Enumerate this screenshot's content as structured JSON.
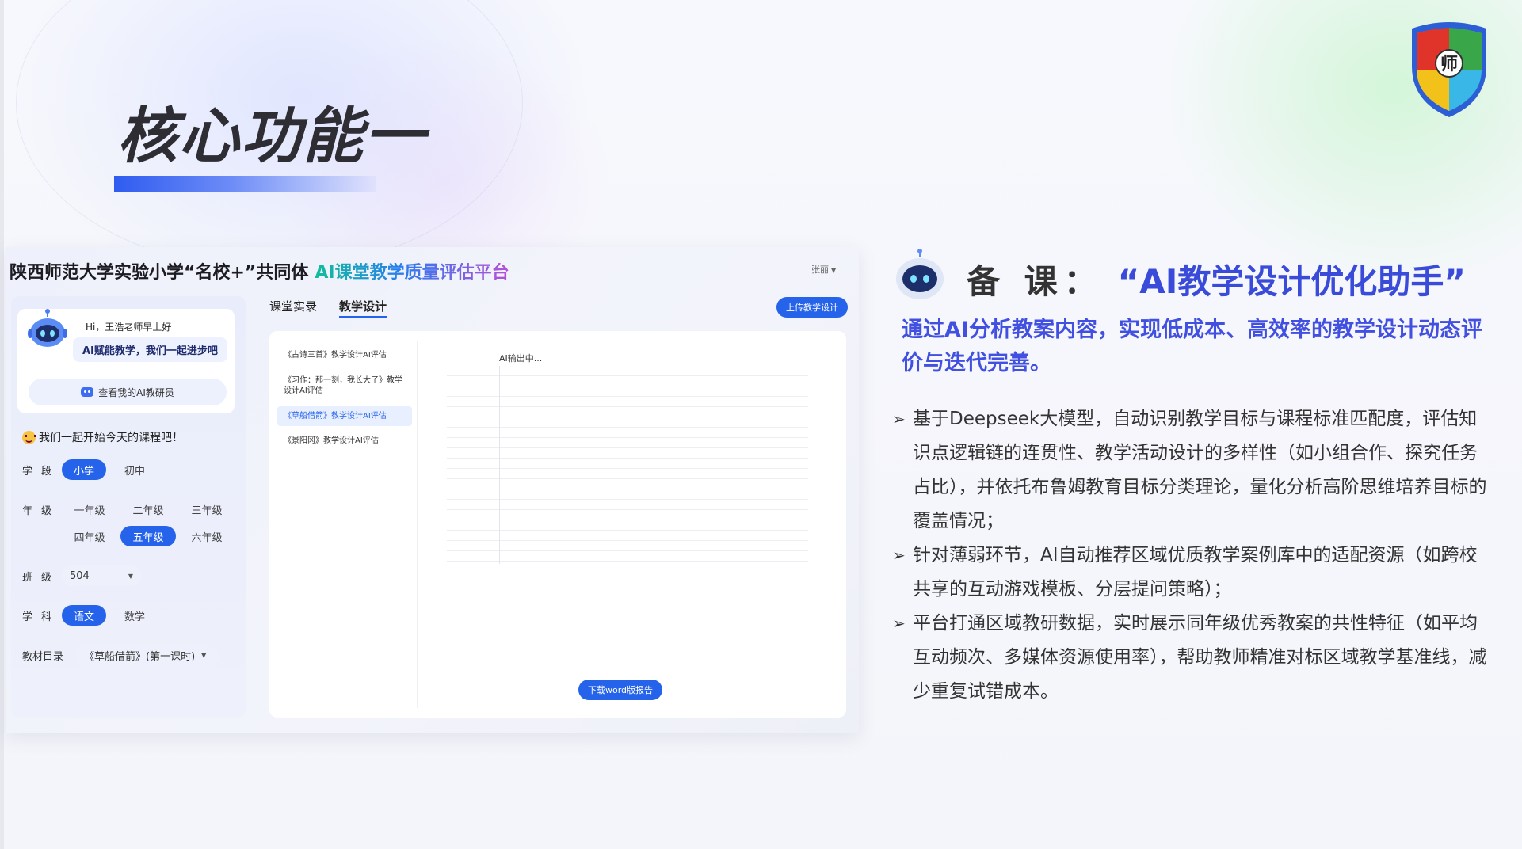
{
  "slide": {
    "title": "核心功能一"
  },
  "app": {
    "title_main": "陕西师范大学实验小学“名校+”共同体",
    "title_accent": "AI课堂教学质量评估平台",
    "user_menu": "张丽",
    "greeting": {
      "hi": "Hi，王浩老师早上好",
      "message": "AI赋能教学，我们一起进步吧",
      "mentor_button": "查看我的AI教研员"
    },
    "start_text": "我们一起开始今天的课程吧！",
    "filters": {
      "stage_label": "学段",
      "stage_options": [
        "小学",
        "初中"
      ],
      "stage_selected": "小学",
      "grade_label": "年级",
      "grade_options": [
        "一年级",
        "二年级",
        "三年级",
        "四年级",
        "五年级",
        "六年级"
      ],
      "grade_selected": "五年级",
      "class_label": "班级",
      "class_value": "504",
      "subject_label": "学科",
      "subject_options": [
        "语文",
        "数学"
      ],
      "subject_selected": "语文",
      "textbook_label": "教材目录",
      "textbook_value": "《草船借箭》(第一课时)"
    },
    "tabs": [
      "课堂实录",
      "教学设计"
    ],
    "active_tab": "教学设计",
    "upload_button": "上传教学设计",
    "docs": [
      "《古诗三首》教学设计AI评估",
      "《习作：那一刻，我长大了》教学设计AI评估",
      "《草船借箭》教学设计AI评估",
      "《景阳冈》教学设计AI评估"
    ],
    "active_doc_index": 2,
    "ai_output_label": "AI输出中...",
    "download_button": "下载word版报告"
  },
  "feature": {
    "heading_prefix": "备 课：",
    "heading_name": "“AI教学设计优化助手”",
    "subtitle": "通过AI分析教案内容，实现低成本、高效率的教学设计动态评价与迭代完善。",
    "bullets": [
      "基于Deepseek大模型，自动识别教学目标与课程标准匹配度，评估知识点逻辑链的连贯性、教学活动设计的多样性（如小组合作、探究任务占比），并依托布鲁姆教育目标分类理论，量化分析高阶思维培养目标的覆盖情况；",
      "针对薄弱环节，AI自动推荐区域优质教学案例库中的适配资源（如跨校共享的互动游戏模板、分层提问策略）；",
      "平台打通区域教研数据，实时展示同年级优秀教案的共性特征（如平均互动频次、多媒体资源使用率），帮助教师精准对标区域教学基准线，减少重复试错成本。"
    ]
  },
  "colors": {
    "primary_blue": "#2563eb",
    "heading_blue": "#3a4bd9",
    "title_dark": "#2d2d33"
  },
  "logo": {
    "char": "师"
  }
}
